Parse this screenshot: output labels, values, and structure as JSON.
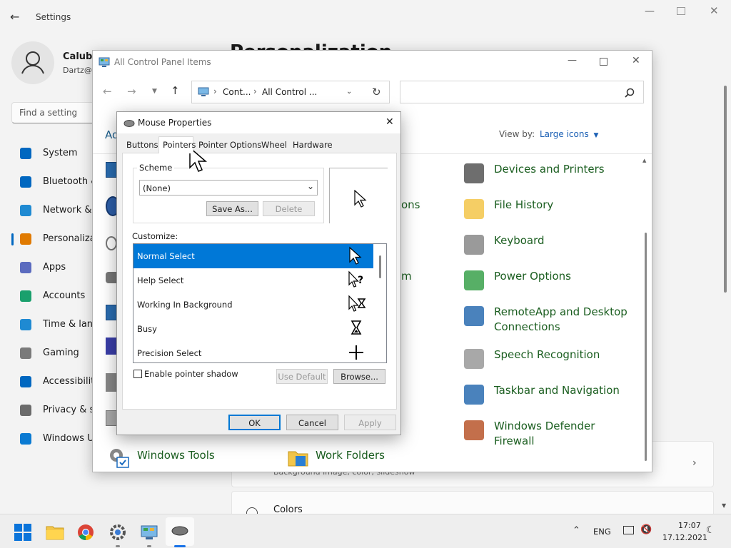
{
  "settings": {
    "title": "Settings",
    "user_name": "Calub W",
    "user_email": "Dartz@",
    "search_placeholder": "Find a setting",
    "page_heading": "Personalization",
    "nav": [
      {
        "label": "System",
        "color": "#0067c0"
      },
      {
        "label": "Bluetooth &",
        "color": "#0067c0"
      },
      {
        "label": "Network &",
        "color": "#1f8ad2"
      },
      {
        "label": "Personaliza",
        "color": "#e07a00"
      },
      {
        "label": "Apps",
        "color": "#5b6bbf"
      },
      {
        "label": "Accounts",
        "color": "#1aa06d"
      },
      {
        "label": "Time & lang",
        "color": "#1f8ad2"
      },
      {
        "label": "Gaming",
        "color": "#7a7a7a"
      },
      {
        "label": "Accessibility",
        "color": "#0067c0"
      },
      {
        "label": "Privacy & se",
        "color": "#6b6b6b"
      },
      {
        "label": "Windows U",
        "color": "#0a7ad2"
      }
    ],
    "card_subtitle": "Background image, color, slideshow",
    "colors_label": "Colors"
  },
  "control_panel": {
    "title": "All Control Panel Items",
    "breadcrumb": [
      "Cont...",
      "All Control ..."
    ],
    "adjust_label": "Ad",
    "view_by_label": "View by:",
    "view_by_value": "Large icons",
    "left_fragments": [
      "ons",
      "m"
    ],
    "items": [
      {
        "label": "Devices and Printers",
        "icon": "printer-icon"
      },
      {
        "label": "File History",
        "icon": "file-history-icon"
      },
      {
        "label": "Keyboard",
        "icon": "keyboard-icon"
      },
      {
        "label": "Power Options",
        "icon": "power-options-icon"
      },
      {
        "label": "RemoteApp and Desktop Connections",
        "icon": "remote-desktop-icon"
      },
      {
        "label": "Speech Recognition",
        "icon": "microphone-icon"
      },
      {
        "label": "Taskbar and Navigation",
        "icon": "taskbar-icon"
      },
      {
        "label": "Windows Defender Firewall",
        "icon": "firewall-icon"
      }
    ],
    "bottom_items": [
      {
        "label": "Windows Tools",
        "icon": "tools-icon"
      },
      {
        "label": "Work Folders",
        "icon": "work-folders-icon"
      }
    ]
  },
  "mouse": {
    "title": "Mouse Properties",
    "tabs": [
      "Buttons",
      "Pointers",
      "Pointer Options",
      "Wheel",
      "Hardware"
    ],
    "active_tab": "Pointers",
    "scheme_label": "Scheme",
    "scheme_value": "(None)",
    "save_as": "Save As...",
    "delete": "Delete",
    "customize_label": "Customize:",
    "list": [
      {
        "label": "Normal Select",
        "icon": "arrow-cursor-icon"
      },
      {
        "label": "Help Select",
        "icon": "help-cursor-icon"
      },
      {
        "label": "Working In Background",
        "icon": "working-cursor-icon"
      },
      {
        "label": "Busy",
        "icon": "busy-cursor-icon"
      },
      {
        "label": "Precision Select",
        "icon": "crosshair-cursor-icon"
      }
    ],
    "selected_index": 0,
    "shadow_label": "Enable pointer shadow",
    "use_default": "Use Default",
    "browse": "Browse...",
    "ok": "OK",
    "cancel": "Cancel",
    "apply": "Apply"
  },
  "taskbar": {
    "lang": "ENG",
    "time": "17:07",
    "date": "17.12.2021"
  }
}
